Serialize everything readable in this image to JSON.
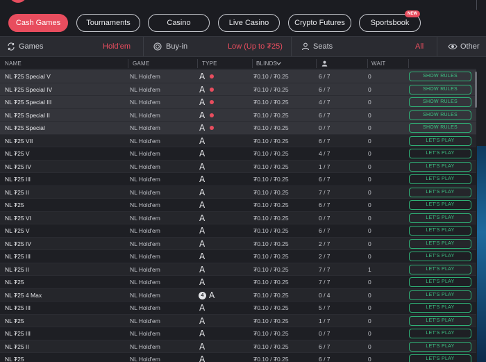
{
  "nav": {
    "categories": [
      {
        "label": "Cash Games",
        "active": true
      },
      {
        "label": "Tournaments",
        "active": false
      },
      {
        "label": "Casino",
        "active": false
      },
      {
        "label": "Live Casino",
        "active": false
      },
      {
        "label": "Crypto Futures",
        "active": false
      },
      {
        "label": "Sportsbook",
        "active": false
      }
    ],
    "new_badge": "NEW"
  },
  "filters": {
    "games_label": "Games",
    "games_value": "Hold'em",
    "buyin_label": "Buy-in",
    "buyin_value": "Low (Up to ₮25)",
    "seats_label": "Seats",
    "seats_value": "All",
    "other_label": "Other"
  },
  "table": {
    "headers": {
      "name": "NAME",
      "game": "GAME",
      "type": "TYPE",
      "blinds": "BLINDS",
      "wait": "WAIT"
    },
    "rows": [
      {
        "name": "NL ₮25 Special V",
        "game": "NL  Hold'em",
        "type": "A",
        "blinds": "₮0.10 / ₮0.25",
        "seats": "6 / 7",
        "wait": "0",
        "action": "SHOW RULES"
      },
      {
        "name": "NL ₮25 Special IV",
        "game": "NL  Hold'em",
        "type": "A",
        "blinds": "₮0.10 / ₮0.25",
        "seats": "6 / 7",
        "wait": "0",
        "action": "SHOW RULES"
      },
      {
        "name": "NL ₮25 Special III",
        "game": "NL  Hold'em",
        "type": "A",
        "blinds": "₮0.10 / ₮0.25",
        "seats": "4 / 7",
        "wait": "0",
        "action": "SHOW RULES"
      },
      {
        "name": "NL ₮25 Special II",
        "game": "NL  Hold'em",
        "type": "A",
        "blinds": "₮0.10 / ₮0.25",
        "seats": "6 / 7",
        "wait": "0",
        "action": "SHOW RULES"
      },
      {
        "name": "NL ₮25 Special",
        "game": "NL  Hold'em",
        "type": "A",
        "blinds": "₮0.10 / ₮0.25",
        "seats": "0 / 7",
        "wait": "0",
        "action": "SHOW RULES"
      },
      {
        "name": "NL ₮25 VII",
        "game": "NL  Hold'em",
        "type": "A",
        "blinds": "₮0.10 / ₮0.25",
        "seats": "6 / 7",
        "wait": "0",
        "action": "LET'S PLAY"
      },
      {
        "name": "NL ₮25 V",
        "game": "NL  Hold'em",
        "type": "A",
        "blinds": "₮0.10 / ₮0.25",
        "seats": "4 / 7",
        "wait": "0",
        "action": "LET'S PLAY"
      },
      {
        "name": "NL ₮25 IV",
        "game": "NL  Hold'em",
        "type": "A",
        "blinds": "₮0.10 / ₮0.25",
        "seats": "1 / 7",
        "wait": "0",
        "action": "LET'S PLAY"
      },
      {
        "name": "NL ₮25 III",
        "game": "NL  Hold'em",
        "type": "A",
        "blinds": "₮0.10 / ₮0.25",
        "seats": "6 / 7",
        "wait": "0",
        "action": "LET'S PLAY"
      },
      {
        "name": "NL ₮25 II",
        "game": "NL  Hold'em",
        "type": "A",
        "blinds": "₮0.10 / ₮0.25",
        "seats": "7 / 7",
        "wait": "0",
        "action": "LET'S PLAY"
      },
      {
        "name": "NL ₮25",
        "game": "NL  Hold'em",
        "type": "A",
        "blinds": "₮0.10 / ₮0.25",
        "seats": "6 / 7",
        "wait": "0",
        "action": "LET'S PLAY"
      },
      {
        "name": "NL ₮25 VI",
        "game": "NL  Hold'em",
        "type": "A",
        "blinds": "₮0.10 / ₮0.25",
        "seats": "0 / 7",
        "wait": "0",
        "action": "LET'S PLAY"
      },
      {
        "name": "NL ₮25 V",
        "game": "NL  Hold'em",
        "type": "A",
        "blinds": "₮0.10 / ₮0.25",
        "seats": "6 / 7",
        "wait": "0",
        "action": "LET'S PLAY"
      },
      {
        "name": "NL ₮25 IV",
        "game": "NL  Hold'em",
        "type": "A",
        "blinds": "₮0.10 / ₮0.25",
        "seats": "2 / 7",
        "wait": "0",
        "action": "LET'S PLAY"
      },
      {
        "name": "NL ₮25 III",
        "game": "NL  Hold'em",
        "type": "A",
        "blinds": "₮0.10 / ₮0.25",
        "seats": "2 / 7",
        "wait": "0",
        "action": "LET'S PLAY"
      },
      {
        "name": "NL ₮25 II",
        "game": "NL  Hold'em",
        "type": "A",
        "blinds": "₮0.10 / ₮0.25",
        "seats": "7 / 7",
        "wait": "1",
        "action": "LET'S PLAY"
      },
      {
        "name": "NL ₮25",
        "game": "NL  Hold'em",
        "type": "A",
        "blinds": "₮0.10 / ₮0.25",
        "seats": "7 / 7",
        "wait": "0",
        "action": "LET'S PLAY"
      },
      {
        "name": "NL ₮25 4 Max",
        "game": "NL  Hold'em",
        "type": "A",
        "max": "4",
        "blinds": "₮0.10 / ₮0.25",
        "seats": "0 / 4",
        "wait": "0",
        "action": "LET'S PLAY"
      },
      {
        "name": "NL ₮25 III",
        "game": "NL  Hold'em",
        "type": "A",
        "blinds": "₮0.10 / ₮0.25",
        "seats": "5 / 7",
        "wait": "0",
        "action": "LET'S PLAY"
      },
      {
        "name": "NL ₮25",
        "game": "NL  Hold'em",
        "type": "A",
        "blinds": "₮0.10 / ₮0.25",
        "seats": "1 / 7",
        "wait": "0",
        "action": "LET'S PLAY"
      },
      {
        "name": "NL ₮25 III",
        "game": "NL  Hold'em",
        "type": "A",
        "blinds": "₮0.10 / ₮0.25",
        "seats": "0 / 7",
        "wait": "0",
        "action": "LET'S PLAY"
      },
      {
        "name": "NL ₮25 II",
        "game": "NL  Hold'em",
        "type": "A",
        "blinds": "₮0.10 / ₮0.25",
        "seats": "6 / 7",
        "wait": "0",
        "action": "LET'S PLAY"
      },
      {
        "name": "NL ₮25",
        "game": "NL  Hold'em",
        "type": "A",
        "blinds": "₮0.10 / ₮0.25",
        "seats": "6 / 7",
        "wait": "0",
        "action": "LET'S PLAY"
      }
    ]
  },
  "icons": {
    "games": "swap-arrows-icon",
    "buyin": "chip-icon",
    "seats": "person-icon",
    "other": "eye-icon",
    "players": "person-icon",
    "sort": "chevron-down-icon"
  },
  "colors": {
    "accent": "#e84d5e",
    "action_green": "#3ec485",
    "background": "#1e1f24"
  }
}
